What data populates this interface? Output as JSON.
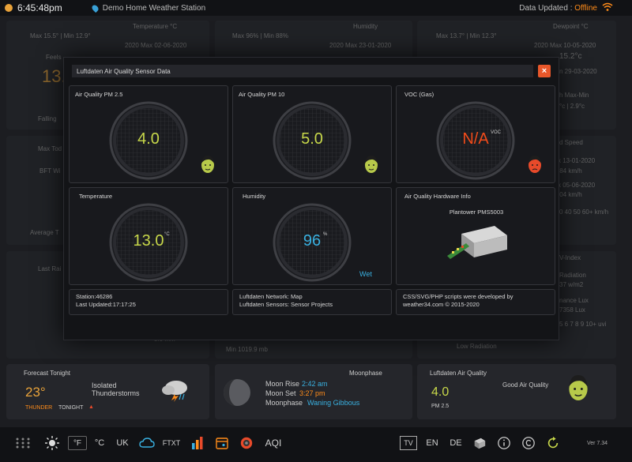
{
  "topbar": {
    "time": "6:45:48pm",
    "station": "Demo Home Weather Station",
    "updated_label": "Data Updated :",
    "updated_status": "Offline"
  },
  "background": {
    "temp_card": {
      "maxmin": "Max 15.5° | Min 12.9°",
      "title": "Temperature °C",
      "record": "2020 Max 02-06-2020",
      "feels": "Feels",
      "big": "13.",
      "falling": "Falling"
    },
    "humidity_card": {
      "maxmin": "Max 96% | Min 88%",
      "title": "Humidity",
      "record": "2020 Max 23-01-2020"
    },
    "dew_card": {
      "maxmin": "Max 13.7° | Min 12.3°",
      "title": "Dewpoint °C",
      "record": "2020 Max 10-05-2020",
      "v1": "15.2°c",
      "v2": "n 29-03-2020",
      "v3": "h Max-Min",
      "v4": "°c | 2.9°c"
    },
    "wind_card": {
      "title": "Max Tod",
      "sub": "BFT Wi",
      "avg": "Average T"
    },
    "windspeed_card": {
      "title": "d Speed",
      "r1": "x 13-01-2020",
      "r2": ".84 km/h",
      "r3": "x 05-06-2020",
      "r4": ".04 km/h",
      "r5": "0 40 50 60+ km/h"
    },
    "rain_card": {
      "title": "Last Rai"
    },
    "uv_card": {
      "title": "V-Index",
      "r1": "Radiation",
      "r2": "37 w/m2",
      "r3": "nance Lux",
      "r4": "7358 Lux",
      "r5": "5 6 7 8 9 10+ uvi"
    },
    "pressure_card": {
      "min": "Min 1019.9 mb",
      "low_rad": "Low Radiation",
      "mid": "5.0 mm"
    }
  },
  "modal": {
    "title": "Luftdaten Air Quality Sensor Data",
    "close_label": "×",
    "panels": [
      {
        "title": "Air Quality PM 2.5",
        "value": "4.0",
        "unit": "",
        "color": "#c8d84a",
        "status": "good"
      },
      {
        "title": "Air Quality PM 10",
        "value": "5.0",
        "unit": "",
        "color": "#c8d84a",
        "status": "good"
      },
      {
        "title": "VOC (Gas)",
        "value": "N/A",
        "unit": "VOC",
        "color": "#f24b1a",
        "status": "bad"
      },
      {
        "title": "Temperature",
        "value": "13.0",
        "unit": "°C",
        "color": "#c8d84a"
      },
      {
        "title": "Humidity",
        "value": "96",
        "unit": "%",
        "color": "#39b0e0",
        "extra": "Wet"
      }
    ],
    "hardware": {
      "title": "Air Quality Hardware Info",
      "name": "Plantower PMS5003"
    },
    "info": {
      "station_line1": "Station:46286",
      "station_line2": "Last Updated:17:17:25",
      "network_line1": "Luftdaten Network: Map",
      "network_line2": "Luftdaten Sensors: Sensor Projects",
      "credit_line1": "CSS/SVG/PHP scripts were developed by",
      "credit_line2": "weather34.com © 2015-2020"
    }
  },
  "forecast": {
    "title": "Forecast Tonight",
    "temp": "23°",
    "desc1": "Isolated",
    "desc2": "Thunderstorms",
    "label_a": "THUNDER",
    "label_b": "TONIGHT"
  },
  "moon": {
    "title": "Moonphase",
    "rise_label": "Moon Rise",
    "rise_time": "2:42 am",
    "set_label": "Moon Set",
    "set_time": "3:27 pm",
    "phase_label": "Moonphase",
    "phase": "Waning Gibbous"
  },
  "airquality": {
    "title": "Luftdaten Air Quality",
    "value": "4.0",
    "sub": "PM 2.5",
    "status": "Good Air Quality"
  },
  "toolbar": {
    "f": "°F",
    "c": "°C",
    "uk": "UK",
    "ftxt": "FTXT",
    "aqi": "AQI",
    "tv": "TV",
    "en": "EN",
    "de": "DE",
    "version": "Ver 7.34"
  },
  "colors": {
    "accent": "#ff8c1a",
    "blue": "#39b0e0",
    "green": "#c8d84a",
    "red": "#f24b1a"
  }
}
